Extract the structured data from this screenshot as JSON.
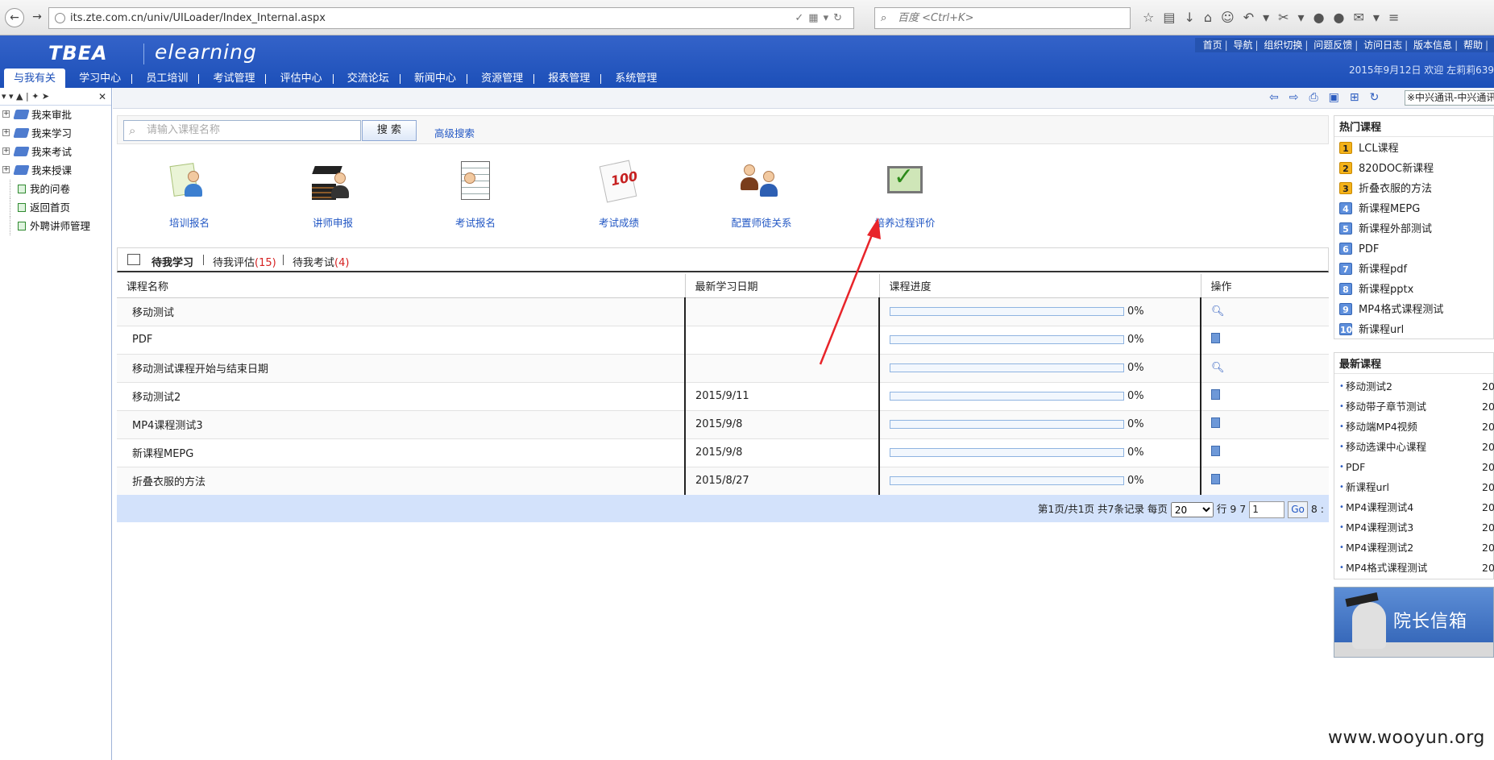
{
  "browser": {
    "url": "its.zte.com.cn/univ/UILoader/Index_Internal.aspx",
    "search_placeholder": "百度 <Ctrl+K>"
  },
  "header": {
    "logo": "TBEA",
    "logo_sub": "elearning",
    "top_links": [
      "首页",
      "导航",
      "组织切换",
      "问题反馈",
      "访问日志",
      "版本信息",
      "帮助"
    ],
    "date_line": "2015年9月12日 欢迎 左莉莉639"
  },
  "nav": {
    "tabs": [
      "与我有关",
      "学习中心",
      "员工培训",
      "考试管理",
      "评估中心",
      "交流论坛",
      "新闻中心",
      "资源管理",
      "报表管理",
      "系统管理"
    ]
  },
  "left_tree": {
    "items": [
      {
        "label": "我来审批",
        "expandable": true
      },
      {
        "label": "我来学习",
        "expandable": true
      },
      {
        "label": "我来考试",
        "expandable": true
      },
      {
        "label": "我来授课",
        "expandable": true
      },
      {
        "label": "我的问卷",
        "expandable": false
      },
      {
        "label": "返回首页",
        "expandable": false
      },
      {
        "label": "外聘讲师管理",
        "expandable": false
      }
    ]
  },
  "sub_toolbar": {
    "company": "※中兴通讯-中兴通讯"
  },
  "search": {
    "placeholder": "请输入课程名称",
    "button": "搜 索",
    "advanced": "高级搜索"
  },
  "quick_links": [
    "培训报名",
    "讲师申报",
    "考试报名",
    "考试成绩",
    "配置师徒关系",
    "培养过程评价"
  ],
  "tabs": {
    "my_study": "待我学习",
    "my_eval": "待我评估",
    "my_eval_count": "(15)",
    "my_exam": "待我考试",
    "my_exam_count": "(4)"
  },
  "table": {
    "headers": [
      "课程名称",
      "最新学习日期",
      "课程进度",
      "操作"
    ],
    "rows": [
      {
        "name": "移动测试",
        "date": "",
        "progress": "0%",
        "progress_value": 0,
        "op": "search-icon"
      },
      {
        "name": "PDF",
        "date": "",
        "progress": "0%",
        "progress_value": 0,
        "op": "document-icon"
      },
      {
        "name": "移动测试课程开始与结束日期",
        "date": "",
        "progress": "0%",
        "progress_value": 0,
        "op": "search-icon"
      },
      {
        "name": "移动测试2",
        "date": "2015/9/11",
        "progress": "0%",
        "progress_value": 0,
        "op": "document-icon"
      },
      {
        "name": "MP4课程测试3",
        "date": "2015/9/8",
        "progress": "0%",
        "progress_value": 0,
        "op": "document-icon"
      },
      {
        "name": "新课程MEPG",
        "date": "2015/9/8",
        "progress": "0%",
        "progress_value": 0,
        "op": "document-icon"
      },
      {
        "name": "折叠衣服的方法",
        "date": "2015/8/27",
        "progress": "0%",
        "progress_value": 0,
        "op": "document-icon"
      }
    ]
  },
  "pager": {
    "summary": "第1页/共1页  共7条记录  每页",
    "per_page": "20",
    "rows_label": "行 9 7",
    "page_value": "1",
    "go": "Go",
    "tail": "8 :"
  },
  "hot_courses": {
    "title": "热门课程",
    "items": [
      "LCL课程",
      "820DOC新课程",
      "折叠衣服的方法",
      "新课程MEPG",
      "新课程外部测试",
      "PDF",
      "新课程pdf",
      "新课程pptx",
      "MP4格式课程测试",
      "新课程url"
    ]
  },
  "new_courses": {
    "title": "最新课程",
    "items": [
      "移动测试2",
      "移动带子章节测试",
      "移动端MP4视频",
      "移动选课中心课程",
      "PDF",
      "新课程url",
      "MP4课程测试4",
      "MP4课程测试3",
      "MP4课程测试2",
      "MP4格式课程测试"
    ],
    "year_prefix": "20"
  },
  "banner": {
    "text": "院长信箱"
  },
  "watermark": "www.wooyun.org",
  "colors": {
    "brand_blue": "#1c4fb8",
    "link_blue": "#2257c4",
    "count_red": "#d62020",
    "annotation_red": "#e8242a"
  }
}
